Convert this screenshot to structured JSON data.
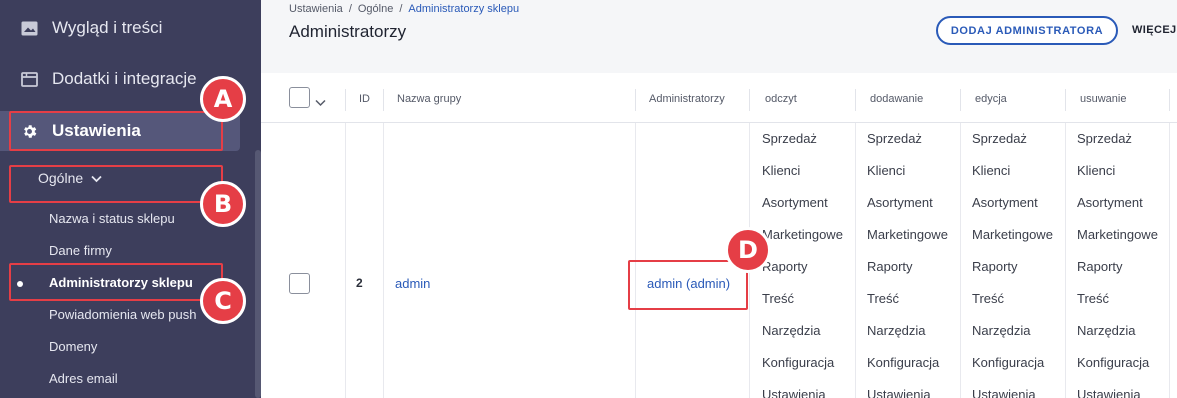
{
  "sidebar": {
    "items": [
      {
        "label": "Wygląd i treści",
        "icon": "image-icon"
      },
      {
        "label": "Dodatki i integracje",
        "icon": "window-icon"
      },
      {
        "label": "Ustawienia",
        "icon": "gear-icon"
      }
    ],
    "submenu": {
      "label": "Ogólne",
      "icon": "chevron-down-icon"
    },
    "subitems": [
      {
        "label": "Nazwa i status sklepu"
      },
      {
        "label": "Dane firmy"
      },
      {
        "label": "Administratorzy sklepu"
      },
      {
        "label": "Powiadomienia web push"
      },
      {
        "label": "Domeny"
      },
      {
        "label": "Adres email"
      }
    ]
  },
  "header": {
    "breadcrumb": [
      "Ustawienia",
      "/",
      "Ogólne",
      "/",
      "Administratorzy sklepu"
    ],
    "title": "Administratorzy",
    "add_button": "DODAJ ADMINISTRATORA",
    "more_button": "WIĘCEJ"
  },
  "table": {
    "columns": [
      "ID",
      "Nazwa grupy",
      "Administratorzy",
      "odczyt",
      "dodawanie",
      "edycja",
      "usuwanie"
    ],
    "row": {
      "id": "2",
      "group": "admin",
      "admins": "admin (admin)",
      "permissions": [
        "Sprzedaż",
        "Klienci",
        "Asortyment",
        "Marketingowe",
        "Raporty",
        "Treść",
        "Narzędzia",
        "Konfiguracja",
        "Ustawienia"
      ]
    }
  },
  "annotations": [
    "A",
    "B",
    "C",
    "D"
  ],
  "colors": {
    "accent": "#2a5ab8",
    "sidebar": "#3d3e5c",
    "annotation": "#e53e46"
  }
}
